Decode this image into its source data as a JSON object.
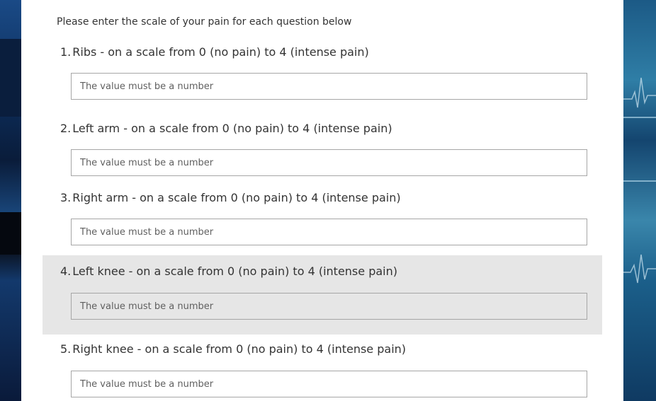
{
  "form": {
    "intro": "Please enter the scale of your pain for each question below",
    "questions": [
      {
        "number": "1.",
        "label": "Ribs - on a scale from 0 (no pain) to 4 (intense pain)",
        "placeholder": "The value must be a number",
        "value": ""
      },
      {
        "number": "2.",
        "label": "Left arm - on a scale from 0 (no pain) to 4 (intense pain)",
        "placeholder": "The value must be a number",
        "value": ""
      },
      {
        "number": "3.",
        "label": "Right arm - on a scale from 0 (no pain) to 4 (intense pain)",
        "placeholder": "The value must be a number",
        "value": ""
      },
      {
        "number": "4.",
        "label": "Left knee - on a scale from 0 (no pain) to 4 (intense pain)",
        "placeholder": "The value must be a number",
        "value": ""
      },
      {
        "number": "5.",
        "label": "Right knee - on a scale from 0 (no pain) to 4 (intense pain)",
        "placeholder": "The value must be a number",
        "value": ""
      }
    ]
  },
  "colors": {
    "card_background": "#ffffff",
    "highlight_background": "#e6e6e6",
    "input_border": "#a6a6a6",
    "text": "#333333",
    "page_background": "#0f3566"
  }
}
